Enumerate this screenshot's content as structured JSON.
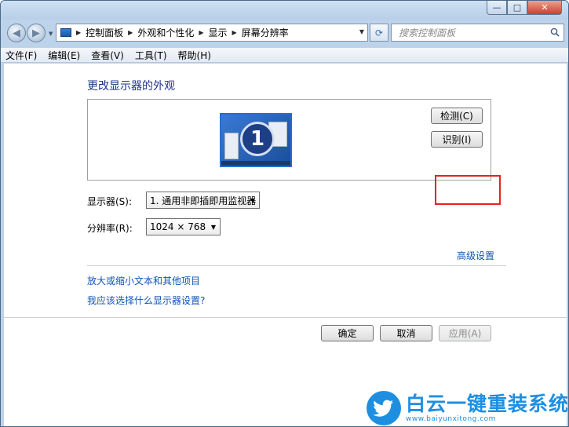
{
  "window": {
    "controls": {
      "minimize": "—",
      "maximize": "□",
      "close": "✕"
    }
  },
  "navbar": {
    "back_icon": "back-arrow-icon",
    "forward_icon": "forward-arrow-icon",
    "breadcrumb": [
      "控制面板",
      "外观和个性化",
      "显示",
      "屏幕分辨率"
    ],
    "search_placeholder": "搜索控制面板"
  },
  "menubar": {
    "items": [
      "文件(F)",
      "编辑(E)",
      "查看(V)",
      "工具(T)",
      "帮助(H)"
    ]
  },
  "main": {
    "title": "更改显示器的外观",
    "monitor_number": "1",
    "detect_button": "检测(C)",
    "identify_button": "识别(I)",
    "display_label": "显示器(S):",
    "display_value": "1. 通用非即插即用监视器",
    "resolution_label": "分辨率(R):",
    "resolution_value": "1024 × 768",
    "advanced_link": "高级设置",
    "link_text_size": "放大或缩小文本和其他项目",
    "link_help": "我应该选择什么显示器设置?",
    "ok_button": "确定",
    "cancel_button": "取消",
    "apply_button": "应用(A)"
  },
  "watermark": {
    "cn": "白云一键重装系统",
    "en": "www.baiyunxitong.com"
  },
  "colors": {
    "link": "#0f55b5",
    "title": "#1e3287",
    "highlight_box": "#e2241d",
    "watermark": "#1e8fe0"
  }
}
